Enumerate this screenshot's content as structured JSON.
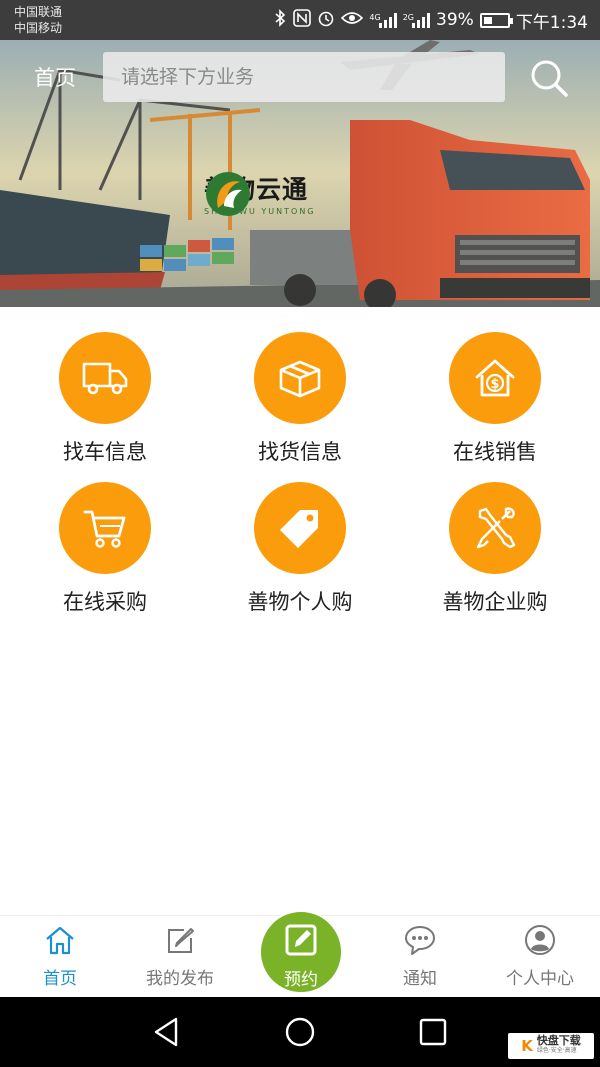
{
  "status_bar": {
    "carrier_1": "中国联通",
    "carrier_2": "中国移动",
    "net_1": "4G",
    "net_2": "2G",
    "battery": "39%",
    "battery_level": 0.39,
    "time": "下午1:34"
  },
  "header": {
    "home_label": "首页",
    "search_placeholder": "请选择下方业务"
  },
  "banner": {
    "logo_cn": "善物云通",
    "logo_en": "SHAN WU YUNTONG"
  },
  "services": [
    {
      "label": "找车信息",
      "icon": "truck-icon"
    },
    {
      "label": "找货信息",
      "icon": "package-icon"
    },
    {
      "label": "在线销售",
      "icon": "house-dollar-icon"
    },
    {
      "label": "在线采购",
      "icon": "cart-icon"
    },
    {
      "label": "善物个人购",
      "icon": "tag-icon"
    },
    {
      "label": "善物企业购",
      "icon": "tools-icon"
    }
  ],
  "tabbar": {
    "home": "首页",
    "my_posts": "我的发布",
    "reserve": "预约",
    "notify": "通知",
    "profile": "个人中心"
  },
  "watermark": {
    "mark": "K",
    "title": "快盘下载",
    "sub": "绿色·安全·高速"
  },
  "colors": {
    "accent_orange": "#fb9c0c",
    "accent_green": "#7ab228",
    "active_blue": "#1d8ecf"
  }
}
